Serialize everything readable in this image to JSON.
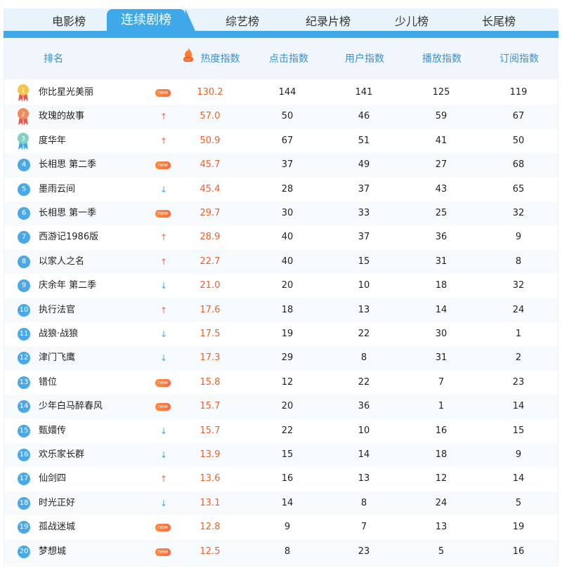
{
  "tabs": [
    "电影榜",
    "连续剧榜",
    "综艺榜",
    "纪录片榜",
    "少儿榜",
    "长尾榜"
  ],
  "active_tab": 1,
  "hot_label": "HOT",
  "columns": [
    "排名",
    "热度指数",
    "点击指数",
    "用户指数",
    "播放指数",
    "订阅指数"
  ],
  "rows": [
    {
      "rank": "1",
      "title": "你比星光美丽",
      "trend": "new",
      "heat": "130.2",
      "click": "144",
      "user": "141",
      "play": "125",
      "sub": "119"
    },
    {
      "rank": "2",
      "title": "玫瑰的故事",
      "trend": "up",
      "heat": "57.0",
      "click": "50",
      "user": "46",
      "play": "59",
      "sub": "67"
    },
    {
      "rank": "3",
      "title": "度华年",
      "trend": "up",
      "heat": "50.9",
      "click": "67",
      "user": "51",
      "play": "41",
      "sub": "50"
    },
    {
      "rank": "4",
      "title": "长相思 第二季",
      "trend": "new",
      "heat": "45.7",
      "click": "37",
      "user": "49",
      "play": "27",
      "sub": "68"
    },
    {
      "rank": "5",
      "title": "墨雨云间",
      "trend": "down",
      "heat": "45.4",
      "click": "28",
      "user": "37",
      "play": "43",
      "sub": "65"
    },
    {
      "rank": "6",
      "title": "长相思 第一季",
      "trend": "new",
      "heat": "29.7",
      "click": "30",
      "user": "33",
      "play": "25",
      "sub": "32"
    },
    {
      "rank": "7",
      "title": "西游记1986版",
      "trend": "up",
      "heat": "28.9",
      "click": "40",
      "user": "37",
      "play": "36",
      "sub": "9"
    },
    {
      "rank": "8",
      "title": "以家人之名",
      "trend": "up",
      "heat": "22.7",
      "click": "40",
      "user": "15",
      "play": "31",
      "sub": "8"
    },
    {
      "rank": "9",
      "title": "庆余年 第二季",
      "trend": "down",
      "heat": "21.0",
      "click": "20",
      "user": "10",
      "play": "18",
      "sub": "32"
    },
    {
      "rank": "10",
      "title": "执行法官",
      "trend": "up",
      "heat": "17.6",
      "click": "18",
      "user": "13",
      "play": "14",
      "sub": "24"
    },
    {
      "rank": "11",
      "title": "战狼·战狼",
      "trend": "down",
      "heat": "17.5",
      "click": "19",
      "user": "22",
      "play": "30",
      "sub": "1"
    },
    {
      "rank": "12",
      "title": "津门飞鹰",
      "trend": "down",
      "heat": "17.3",
      "click": "29",
      "user": "8",
      "play": "31",
      "sub": "2"
    },
    {
      "rank": "13",
      "title": "错位",
      "trend": "new",
      "heat": "15.8",
      "click": "12",
      "user": "22",
      "play": "7",
      "sub": "23"
    },
    {
      "rank": "14",
      "title": "少年白马醉春风",
      "trend": "new",
      "heat": "15.7",
      "click": "20",
      "user": "36",
      "play": "1",
      "sub": "14"
    },
    {
      "rank": "15",
      "title": "甄嬛传",
      "trend": "down",
      "heat": "15.7",
      "click": "22",
      "user": "10",
      "play": "16",
      "sub": "15"
    },
    {
      "rank": "16",
      "title": "欢乐家长群",
      "trend": "down",
      "heat": "13.9",
      "click": "15",
      "user": "14",
      "play": "18",
      "sub": "9"
    },
    {
      "rank": "17",
      "title": "仙剑四",
      "trend": "up",
      "heat": "13.6",
      "click": "16",
      "user": "13",
      "play": "12",
      "sub": "14"
    },
    {
      "rank": "18",
      "title": "时光正好",
      "trend": "down",
      "heat": "13.1",
      "click": "14",
      "user": "8",
      "play": "24",
      "sub": "5"
    },
    {
      "rank": "19",
      "title": "孤战迷城",
      "trend": "new",
      "heat": "12.8",
      "click": "9",
      "user": "7",
      "play": "13",
      "sub": "19"
    },
    {
      "rank": "20",
      "title": "梦想城",
      "trend": "new",
      "heat": "12.5",
      "click": "8",
      "user": "23",
      "play": "5",
      "sub": "16"
    }
  ],
  "trend_labels": {
    "new": "new",
    "up": "↑",
    "down": "↓"
  },
  "colors": {
    "accent": "#3fa8e9",
    "heat": "#e8612c",
    "up": "#e86a50",
    "down": "#3fa8e9",
    "header_text": "#3a8fd0"
  }
}
